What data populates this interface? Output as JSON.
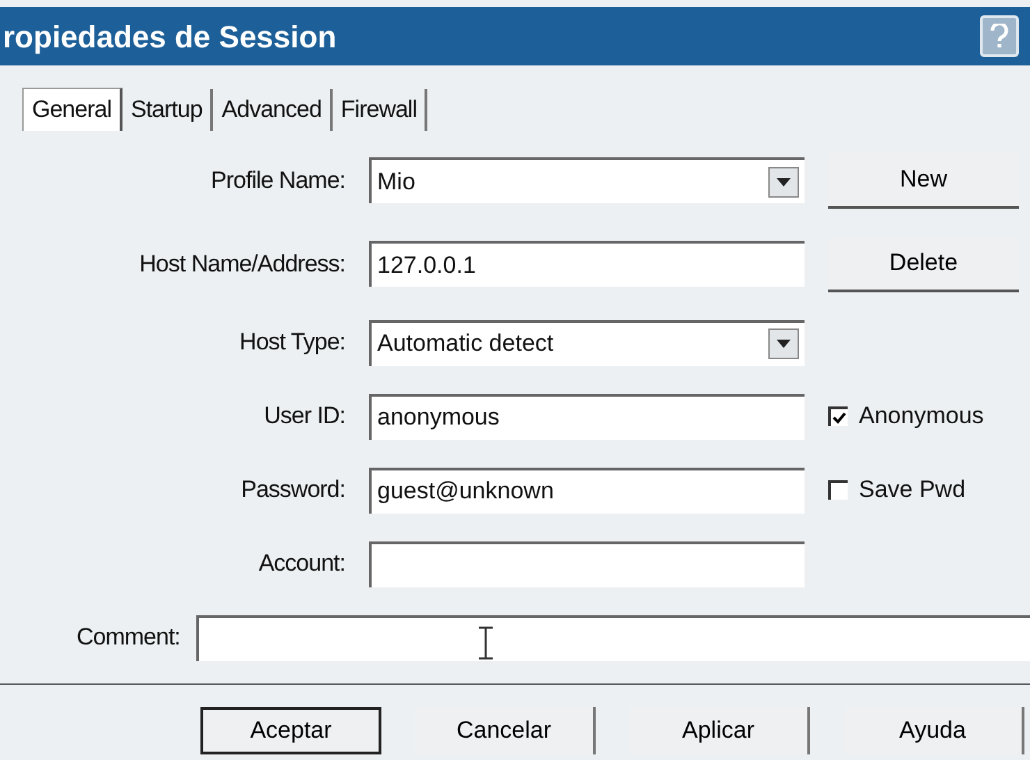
{
  "window": {
    "title": "ropiedades de Session"
  },
  "tabs": [
    {
      "label": "General",
      "selected": true
    },
    {
      "label": "Startup",
      "selected": false
    },
    {
      "label": "Advanced",
      "selected": false
    },
    {
      "label": "Firewall",
      "selected": false
    }
  ],
  "fields": [
    {
      "label": "Profile Name:",
      "kind": "combo",
      "value": "Mio",
      "side": {
        "kind": "button",
        "label": "New"
      }
    },
    {
      "label": "Host Name/Address:",
      "kind": "text",
      "value": "127.0.0.1",
      "side": {
        "kind": "button",
        "label": "Delete"
      }
    },
    {
      "label": "Host Type:",
      "kind": "combo",
      "value": "Automatic detect"
    },
    {
      "label": "User ID:",
      "kind": "text",
      "value": "anonymous",
      "side": {
        "kind": "checkbox",
        "label": "Anonymous",
        "checked": true
      }
    },
    {
      "label": "Password:",
      "kind": "text",
      "value": "guest@unknown",
      "side": {
        "kind": "checkbox",
        "label": "Save Pwd",
        "checked": false
      }
    },
    {
      "label": "Account:",
      "kind": "text"
    }
  ],
  "comment": {
    "label": "Comment:"
  },
  "buttons": [
    {
      "label": "Aceptar",
      "default": true
    },
    {
      "label": "Cancelar",
      "default": false
    },
    {
      "label": "Aplicar",
      "default": false
    },
    {
      "label": "Ayuda",
      "default": false
    }
  ]
}
